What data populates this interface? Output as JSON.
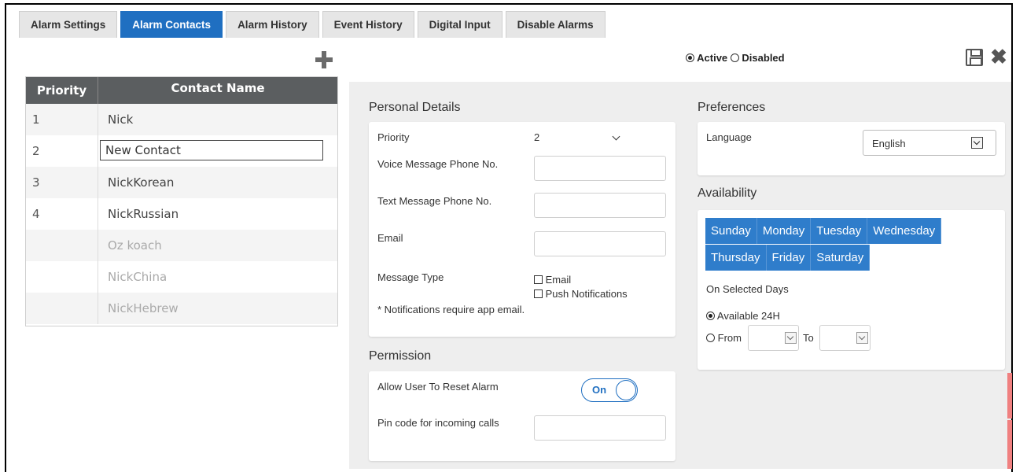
{
  "tabs": [
    {
      "label": "Alarm Settings",
      "active": false
    },
    {
      "label": "Alarm Contacts",
      "active": true
    },
    {
      "label": "Alarm History",
      "active": false
    },
    {
      "label": "Event History",
      "active": false
    },
    {
      "label": "Digital Input",
      "active": false
    },
    {
      "label": "Disable Alarms",
      "active": false
    }
  ],
  "contacts": {
    "headers": {
      "priority": "Priority",
      "name": "Contact Name"
    },
    "rows": [
      {
        "priority": "1",
        "name": "Nick"
      },
      {
        "priority": "2",
        "name": "New Contact",
        "editing": true
      },
      {
        "priority": "3",
        "name": "NickKorean"
      },
      {
        "priority": "4",
        "name": "NickRussian"
      },
      {
        "priority": "",
        "name": "Oz koach",
        "disabled": true
      },
      {
        "priority": "",
        "name": "NickChina",
        "disabled": true
      },
      {
        "priority": "",
        "name": "NickHebrew",
        "disabled": true
      }
    ]
  },
  "status": {
    "active_label": "Active",
    "disabled_label": "Disabled",
    "selected": "Active"
  },
  "personal": {
    "title": "Personal Details",
    "priority_label": "Priority",
    "priority_value": "2",
    "voice_label": "Voice Message Phone No.",
    "voice_value": "",
    "text_label": "Text Message Phone No.",
    "text_value": "",
    "email_label": "Email",
    "email_value": "",
    "msgtype_label": "Message Type",
    "opt_email": "Email",
    "opt_push": "Push Notifications",
    "note": "* Notifications require app email."
  },
  "permission": {
    "title": "Permission",
    "reset_label": "Allow User To Reset Alarm",
    "toggle_label": "On",
    "pin_label": "Pin code for incoming calls",
    "pin_value": ""
  },
  "preferences": {
    "title": "Preferences",
    "language_label": "Language",
    "language_value": "English"
  },
  "availability": {
    "title": "Availability",
    "days_row1": [
      "Sunday",
      "Monday",
      "Tuesday",
      "Wednesday"
    ],
    "days_row2": [
      "Thursday",
      "Friday",
      "Saturday"
    ],
    "on_selected": "On Selected Days",
    "avail24": "Available 24H",
    "from": "From",
    "to": "To",
    "selected_mode": "Available 24H"
  },
  "colors": {
    "accent": "#1f6fc1",
    "day_bg": "#2f7dcb",
    "header_bg": "#5b5e60",
    "panel_bg": "#eeeeee"
  }
}
